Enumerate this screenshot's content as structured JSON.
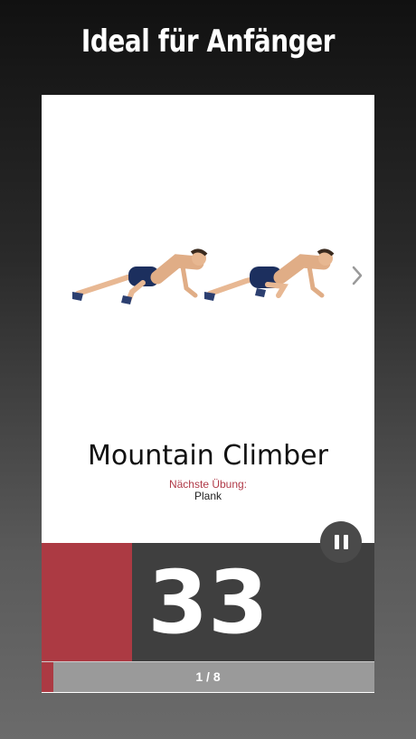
{
  "headline": "Ideal für Anfänger",
  "exercise": {
    "name": "Mountain Climber",
    "next_label": "Nächste Übung:",
    "next_value": "Plank"
  },
  "timer": {
    "seconds": "33"
  },
  "progress": {
    "label": "1 / 8",
    "current": 1,
    "total": 8
  },
  "icons": {
    "next": "chevron-right-icon",
    "pause": "pause-icon"
  },
  "colors": {
    "accent": "#ac3a43",
    "timer_panel": "#3f3f3f",
    "progress_track": "#9a9a9a",
    "next_label": "#b03a48"
  }
}
